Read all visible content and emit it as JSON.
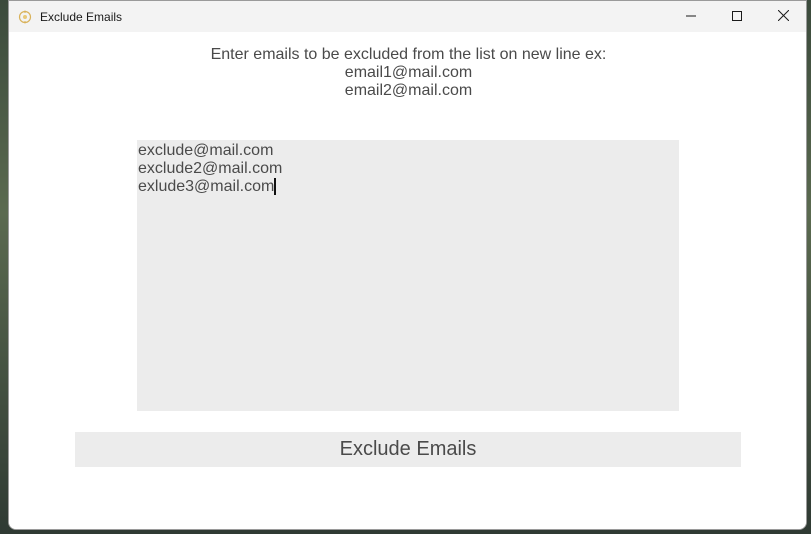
{
  "window": {
    "title": "Exclude Emails",
    "icon": "app-icon"
  },
  "controls": {
    "minimize_icon": "minimize-icon",
    "maximize_icon": "maximize-icon",
    "close_icon": "close-icon"
  },
  "instructions": {
    "line1": "Enter emails to be excluded from the list on new line ex:",
    "line2": "email1@mail.com",
    "line3": "email2@mail.com"
  },
  "email_input": {
    "lines": [
      "exclude@mail.com",
      "exclude2@mail.com",
      "exlude3@mail.com"
    ]
  },
  "action": {
    "button_label": "Exclude Emails"
  },
  "colors": {
    "input_background": "#ececec",
    "text": "#4a4a4a",
    "titlebar": "#f3f3f3"
  }
}
